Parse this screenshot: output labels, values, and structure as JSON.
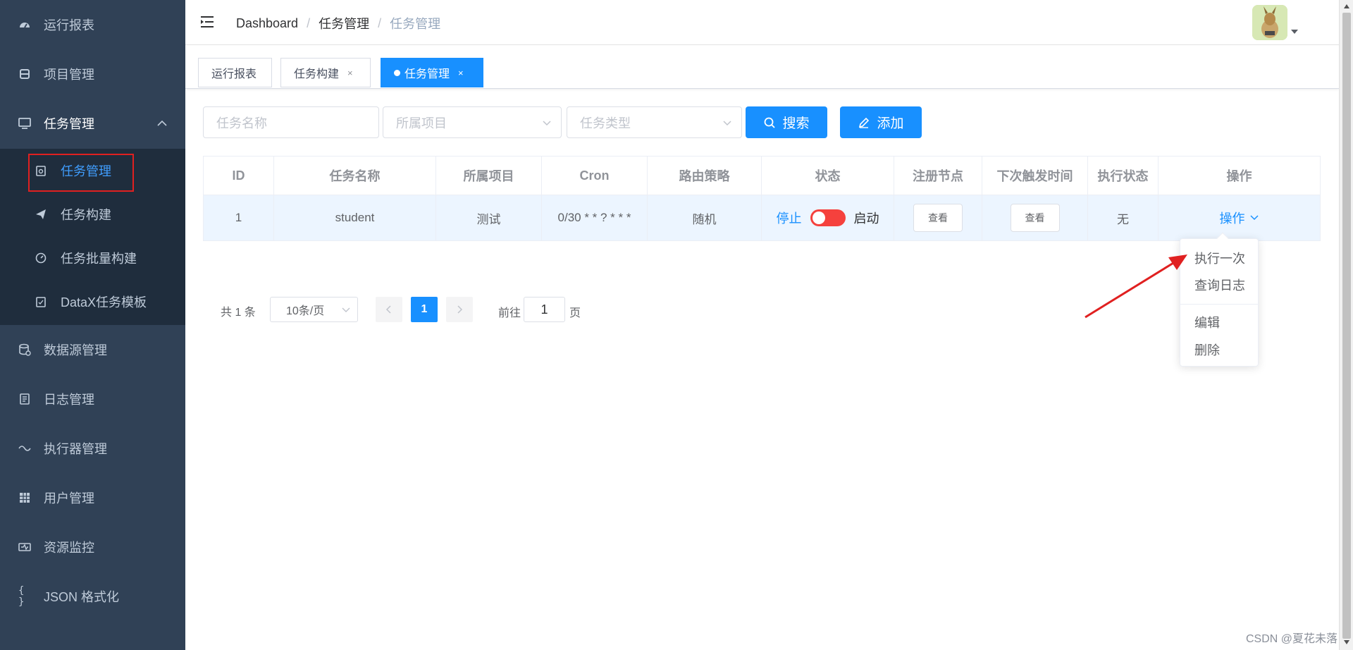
{
  "sidebar": {
    "items": [
      {
        "label": "运行报表",
        "icon": "dashboard-icon"
      },
      {
        "label": "项目管理",
        "icon": "project-icon"
      },
      {
        "label": "任务管理",
        "icon": "monitor-icon"
      },
      {
        "label": "数据源管理",
        "icon": "database-icon"
      },
      {
        "label": "日志管理",
        "icon": "log-icon"
      },
      {
        "label": "执行器管理",
        "icon": "executor-icon"
      },
      {
        "label": "用户管理",
        "icon": "user-table-icon"
      },
      {
        "label": "资源监控",
        "icon": "monitor-resource-icon"
      },
      {
        "label": "JSON 格式化",
        "icon": "json-icon"
      }
    ],
    "submenu": [
      {
        "label": "任务管理",
        "active": true
      },
      {
        "label": "任务构建"
      },
      {
        "label": "任务批量构建"
      },
      {
        "label": "DataX任务模板"
      }
    ]
  },
  "navbar": {
    "breadcrumb": [
      "Dashboard",
      "任务管理",
      "任务管理"
    ],
    "separator": "/"
  },
  "tags": [
    {
      "label": "运行报表"
    },
    {
      "label": "任务构建",
      "close": "×"
    },
    {
      "label": "任务管理",
      "close": "×",
      "active": true
    }
  ],
  "filters": {
    "task_name_placeholder": "任务名称",
    "project_placeholder": "所属项目",
    "task_type_placeholder": "任务类型",
    "search_label": "搜索",
    "add_label": "添加"
  },
  "table": {
    "headers": [
      "ID",
      "任务名称",
      "所属项目",
      "Cron",
      "路由策略",
      "状态",
      "注册节点",
      "下次触发时间",
      "执行状态",
      "操作"
    ],
    "rows": [
      {
        "id": "1",
        "name": "student",
        "project": "测试",
        "cron": "0/30 * * ? * * *",
        "route": "随机",
        "status_off": "停止",
        "status_on": "启动",
        "status_enabled": false,
        "nodes_btn": "查看",
        "next_trigger_btn": "查看",
        "exec_status": "无",
        "op_label": "操作"
      }
    ]
  },
  "dropdown": {
    "items": [
      "执行一次",
      "查询日志",
      "编辑",
      "删除"
    ]
  },
  "pagination": {
    "total_text": "共 1 条",
    "page_size": "10条/页",
    "current_page": "1",
    "goto_label": "前往",
    "goto_value": "1",
    "page_suffix": "页"
  },
  "watermark": "CSDN @夏花未落",
  "colors": {
    "sidebar_bg": "#304156",
    "submenu_bg": "#1f2d3d",
    "primary": "#1890ff",
    "switch_off": "#f5413d",
    "annotation_red": "#e02020"
  }
}
